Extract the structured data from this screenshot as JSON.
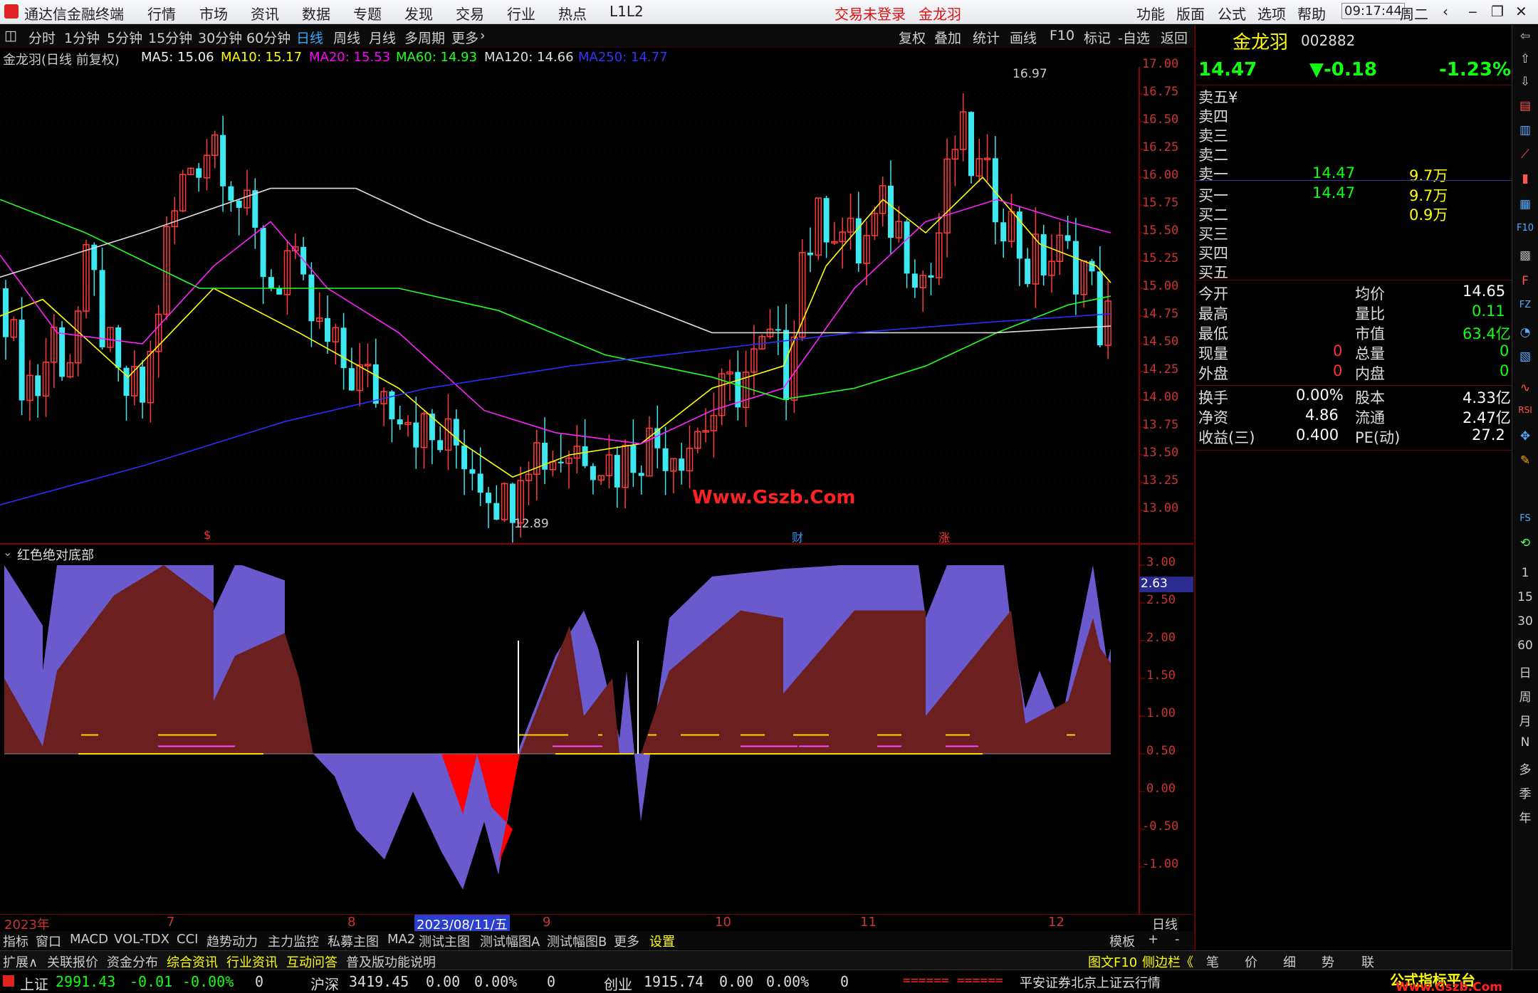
{
  "app": {
    "title": "通达信金融终端",
    "menu": [
      "行情",
      "市场",
      "资讯",
      "数据",
      "专题",
      "发现",
      "交易",
      "行业",
      "热点",
      "L1L2"
    ],
    "login_status": "交易未登录",
    "stock_title": "金龙羽",
    "right_menu": [
      "功能",
      "版面",
      "公式",
      "选项",
      "帮助"
    ],
    "time": "09:17:44",
    "weekday": "周二"
  },
  "periods": [
    "分时",
    "1分钟",
    "5分钟",
    "15分钟",
    "30分钟",
    "60分钟",
    "日线",
    "周线",
    "月线",
    "多周期",
    "更多"
  ],
  "active_period": "日线",
  "tools": [
    "复权",
    "叠加",
    "统计",
    "画线",
    "F10",
    "标记",
    "-自选",
    "返回"
  ],
  "ma_line": {
    "label": "金龙羽(日线 前复权)",
    "ma5": "MA5: 15.06",
    "ma10": "MA10: 15.17",
    "ma20": "MA20: 15.53",
    "ma60": "MA60: 14.93",
    "ma120": "MA120: 14.66",
    "ma250": "MA250: 14.77"
  },
  "price_axis": [
    "17.00",
    "16.75",
    "16.50",
    "16.25",
    "16.00",
    "15.75",
    "15.50",
    "15.25",
    "15.00",
    "14.75",
    "14.50",
    "14.25",
    "14.00",
    "13.75",
    "13.50",
    "13.25",
    "13.00"
  ],
  "annotations": {
    "high": "16.97",
    "low": "12.89",
    "watermark": "Www.Gszb.Com",
    "marker_s": "$",
    "marker_cai": "财",
    "marker_zhang": "涨"
  },
  "indicator": {
    "name": "红色绝对底部",
    "axis": [
      "3.00",
      "2.50",
      "2.00",
      "1.50",
      "1.00",
      "0.50",
      "0.00",
      "-0.50",
      "-1.00"
    ],
    "current_value": "2.63"
  },
  "date_axis": {
    "labels": [
      "2023年",
      "7",
      "8",
      "2023/08/11/五",
      "9",
      "10",
      "11",
      "12"
    ],
    "right_label": "日线"
  },
  "bottom_tabs": [
    "指标",
    "窗口",
    "MACD",
    "VOL-TDX",
    "CCI",
    "趋势动力",
    "主力监控",
    "私募主图",
    "MA2",
    "测试主图",
    "测试幅图A",
    "测试幅图B",
    "更多",
    "设置"
  ],
  "bottom_right": [
    "模板",
    "+",
    "-"
  ],
  "ext_tabs": [
    "扩展∧",
    "关联报价",
    "资金分布",
    "综合资讯",
    "行业资讯",
    "互动问答",
    "普及版功能说明"
  ],
  "ext_right": [
    "图文F10",
    "侧边栏《",
    "笔",
    "价",
    "细",
    "势",
    "联"
  ],
  "quote": {
    "name": "金龙羽",
    "code": "002882",
    "price": "14.47",
    "change": "▼-0.18",
    "pct": "-1.23%",
    "asks": [
      {
        "label": "卖五",
        "price": "",
        "vol": "",
        "note": "¥"
      },
      {
        "label": "卖四",
        "price": "",
        "vol": ""
      },
      {
        "label": "卖三",
        "price": "",
        "vol": ""
      },
      {
        "label": "卖二",
        "price": "",
        "vol": ""
      },
      {
        "label": "卖一",
        "price": "14.47",
        "vol": "9.7万"
      }
    ],
    "bids": [
      {
        "label": "买一",
        "price": "14.47",
        "vol": "9.7万"
      },
      {
        "label": "买二",
        "price": "",
        "vol": "0.9万"
      },
      {
        "label": "买三",
        "price": "",
        "vol": ""
      },
      {
        "label": "买四",
        "price": "",
        "vol": ""
      },
      {
        "label": "买五",
        "price": "",
        "vol": ""
      }
    ],
    "stats": [
      [
        "今开",
        "",
        "均价",
        "14.65"
      ],
      [
        "最高",
        "",
        "量比",
        "0.11"
      ],
      [
        "最低",
        "",
        "市值",
        "63.4亿"
      ],
      [
        "现量",
        "0",
        "总量",
        "0"
      ],
      [
        "外盘",
        "0",
        "内盘",
        "0"
      ]
    ],
    "stats2": [
      [
        "换手",
        "0.00%",
        "股本",
        "4.33亿"
      ],
      [
        "净资",
        "4.86",
        "流通",
        "2.47亿"
      ],
      [
        "收益(三)",
        "0.400",
        "PE(动)",
        "27.2"
      ]
    ]
  },
  "side_icons": [
    "1",
    "15",
    "30",
    "60",
    "日",
    "周",
    "月",
    "N",
    "多",
    "季",
    "年"
  ],
  "status": {
    "sh_label": "上证",
    "sh": "2991.43",
    "sh_chg": "-0.01",
    "sh_pct": "-0.00%",
    "sh_vol": "0",
    "hs_label": "沪深",
    "hs": "3419.45",
    "hs_chg": "0.00",
    "hs_pct": "0.00%",
    "hs_vol": "0",
    "cy_label": "创业",
    "cy": "1915.74",
    "cy_chg": "0.00",
    "cy_pct": "0.00%",
    "cy_vol": "0",
    "ticker": "====== ======",
    "broker": "平安证券北京上证云行情",
    "brand1": "公式指标平台",
    "brand2": "Www.Gszb.Com"
  }
}
